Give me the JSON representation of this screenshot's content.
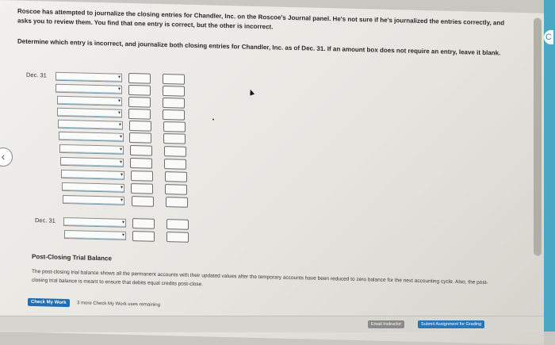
{
  "problem": {
    "intro": "Roscoe has attempted to journalize the closing entries for Chandler, Inc. on the Roscoe's Journal panel. He's not sure if he's journalized the entries correctly, and asks you to review them. You find that one entry is correct, but the other is incorrect.",
    "instruction": "Determine which entry is incorrect, and journalize both closing entries for Chandler, Inc. as of Dec. 31. If an amount box does not require an entry, leave it blank."
  },
  "journal": {
    "entry1_date": "Dec. 31",
    "entry2_date": "Dec. 31",
    "dropdown_caret": "▾"
  },
  "post_closing": {
    "title": "Post-Closing Trial Balance",
    "text": "The post-closing trial balance shows all the permanent accounts with their updated values after the temporary accounts have been reduced to zero balance for the next accounting cycle. Also, the post-closing trial balance is meant to ensure that debits equal credits post-close."
  },
  "check": {
    "button": "Check My Work",
    "remaining": "3 more Check My Work uses remaining"
  },
  "footer": {
    "email": "Email Instructor",
    "submit": "Submit Assignment for Grading"
  },
  "nav": {
    "back_glyph": "‹",
    "side_glyph": "C"
  }
}
